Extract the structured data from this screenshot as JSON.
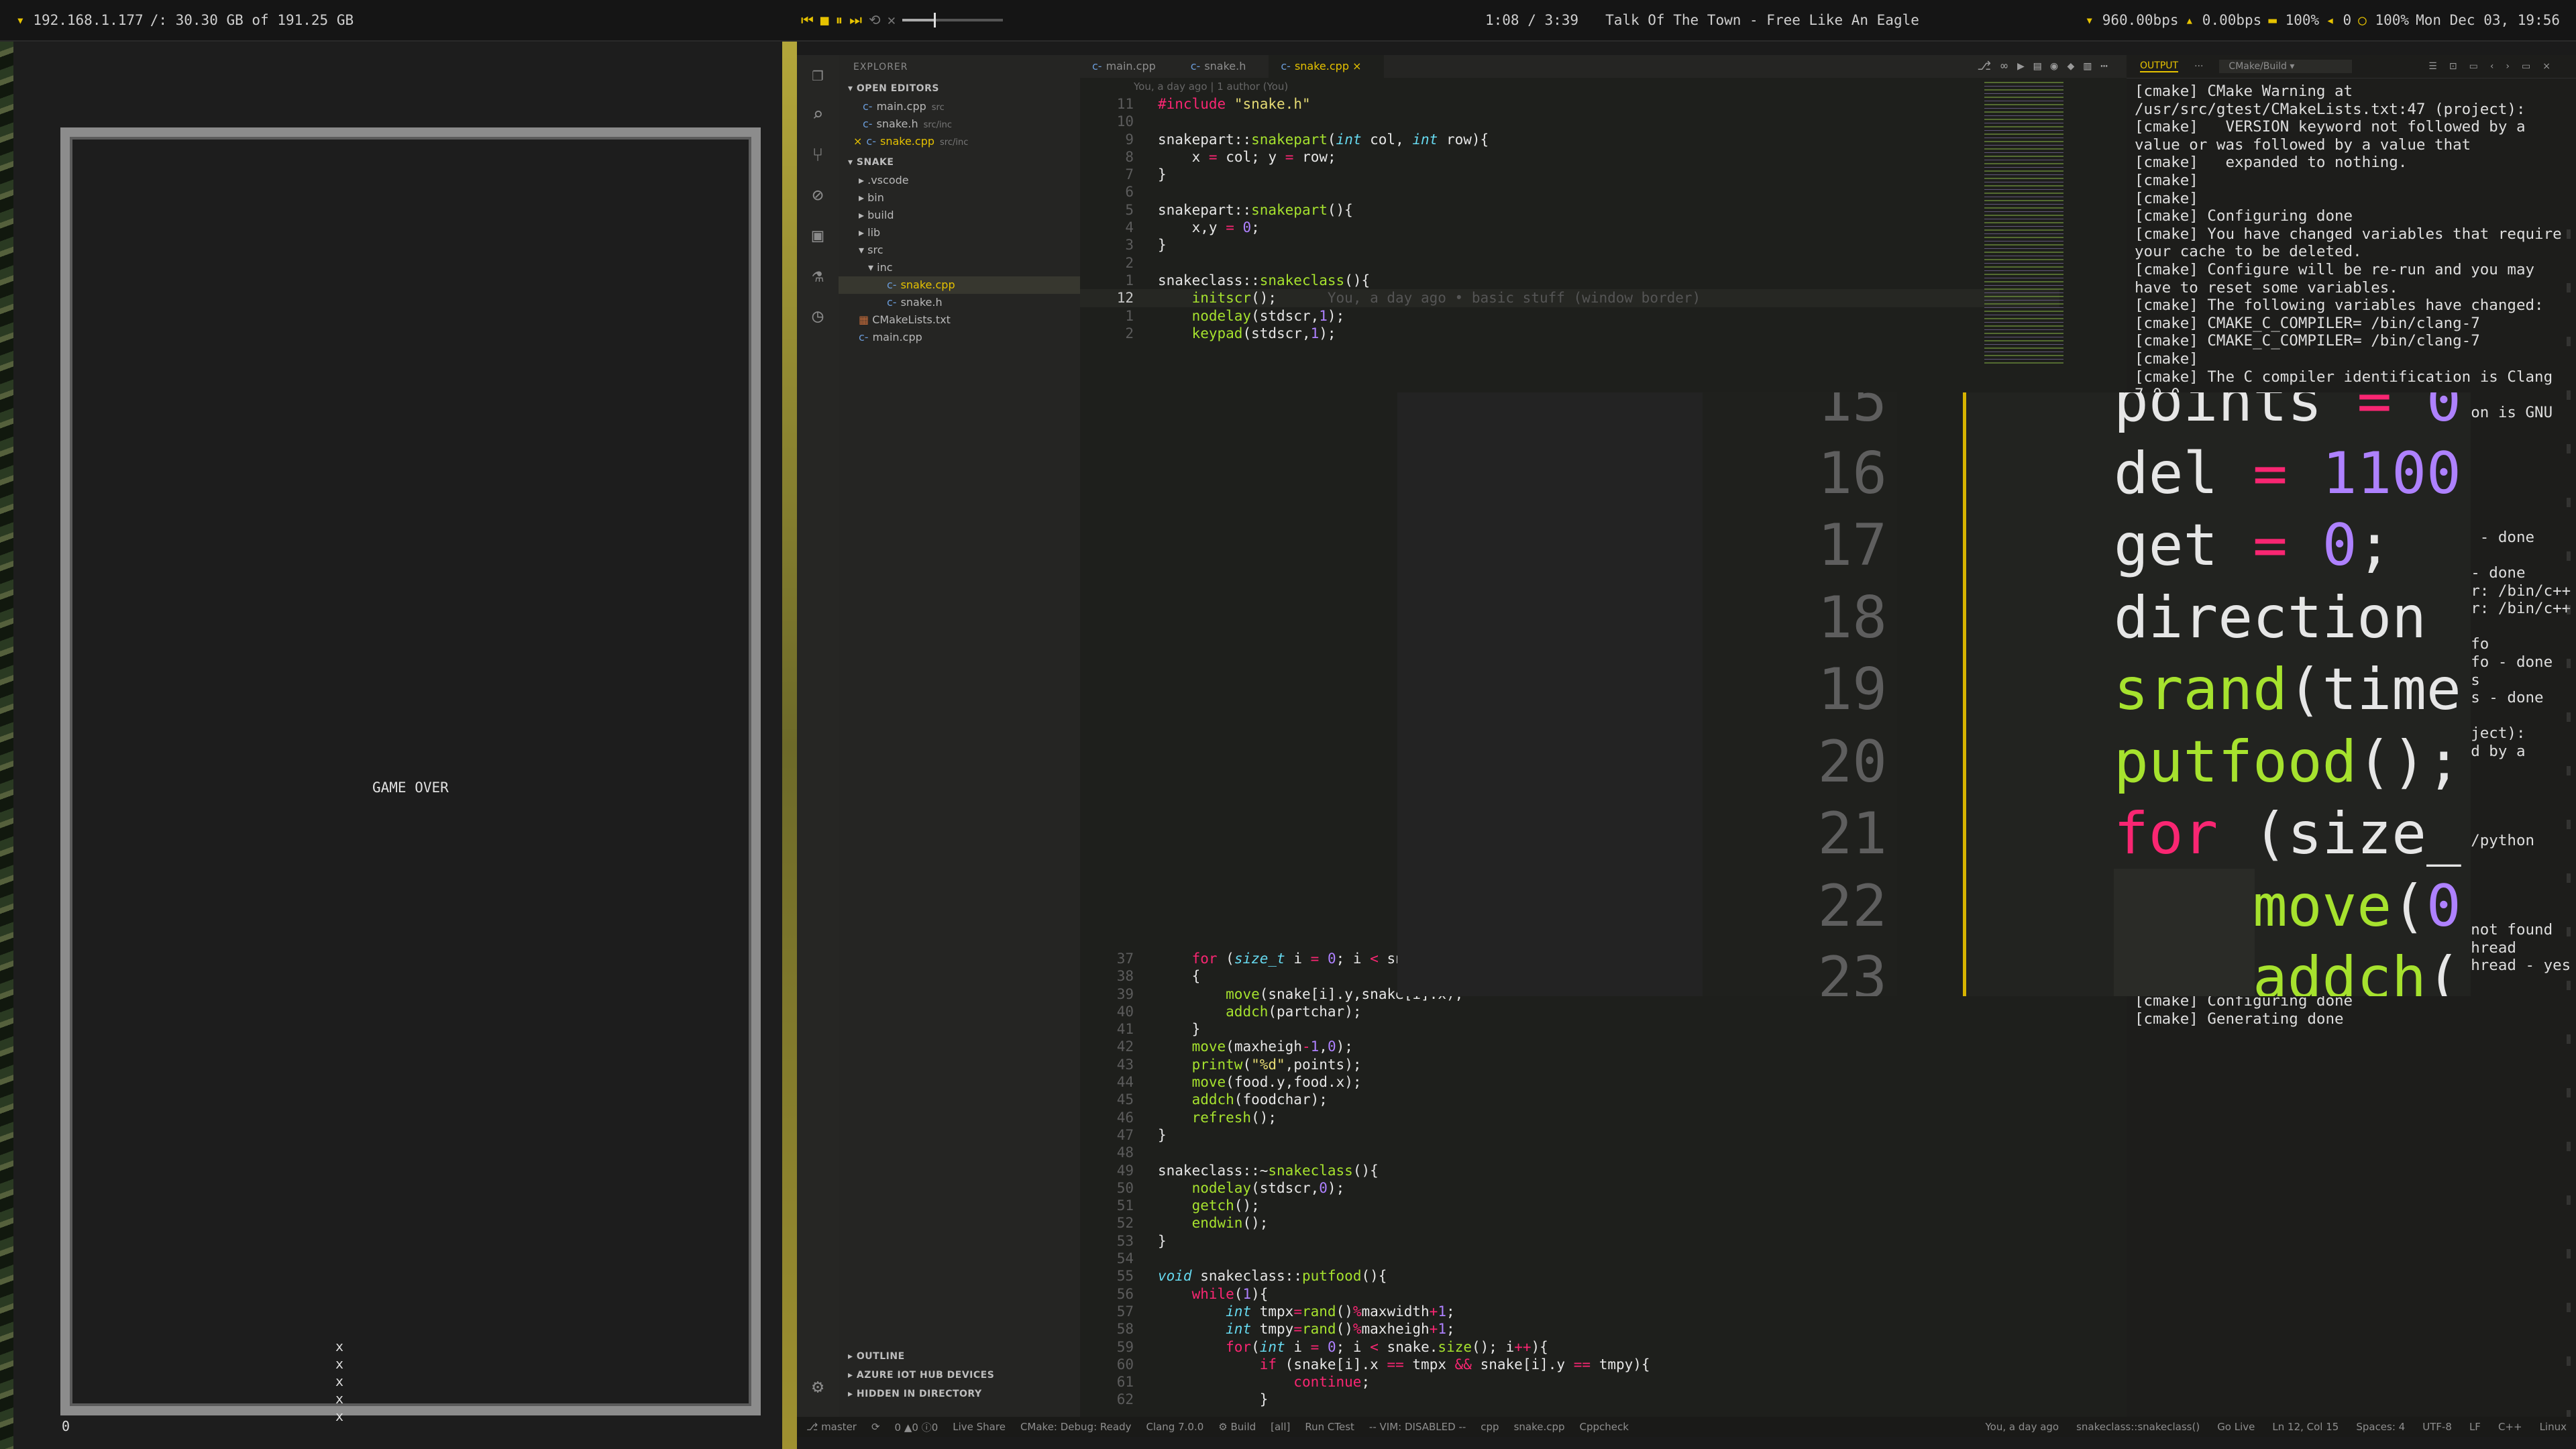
{
  "topbar": {
    "ip": "192.168.1.177",
    "disk": "/: 30.30 GB of 191.25 GB",
    "time_pos": "1:08 / 3:39",
    "track": "Talk Of The Town - Free Like An Eagle",
    "seek_progress": 0.31,
    "down": "960.00bps",
    "up": "0.00bps",
    "battery": "100%",
    "volume": "0",
    "brightness": "100%",
    "datetime": "Mon Dec 03, 19:56"
  },
  "game": {
    "message": "GAME OVER",
    "snake": "x\nx\nx\nx\nx",
    "score": "0"
  },
  "sidebar": {
    "header": "EXPLORER",
    "open_editors": "OPEN EDITORS",
    "open_files": [
      {
        "name": "main.cpp",
        "hint": "src"
      },
      {
        "name": "snake.h",
        "hint": "src/inc"
      },
      {
        "name": "snake.cpp",
        "hint": "src/inc"
      }
    ],
    "project": "SNAKE",
    "tree": [
      ".vscode",
      "bin",
      "build",
      "lib",
      "src",
      "inc",
      "snake.cpp",
      "snake.h",
      "CMakeLists.txt",
      "main.cpp"
    ],
    "outline": "OUTLINE",
    "azure": "AZURE IOT HUB DEVICES",
    "hidden": "HIDDEN IN DIRECTORY"
  },
  "tabs": [
    {
      "label": "main.cpp"
    },
    {
      "label": "snake.h"
    },
    {
      "label": "snake.cpp",
      "close": "×"
    }
  ],
  "editor": {
    "blame_top": "You, a day ago | 1 author (You)",
    "blame_inline": "You, a day ago • basic stuff (window border)",
    "top_lines": [
      {
        "n": "11",
        "t": "#include \"snake.h\""
      },
      {
        "n": "10",
        "t": ""
      },
      {
        "n": "9",
        "t": "snakepart::snakepart(int col, int row){"
      },
      {
        "n": "8",
        "t": "    x = col; y = row;"
      },
      {
        "n": "7",
        "t": "}"
      },
      {
        "n": "6",
        "t": ""
      },
      {
        "n": "5",
        "t": "snakepart::snakepart(){"
      },
      {
        "n": "4",
        "t": "    x,y = 0;"
      },
      {
        "n": "3",
        "t": "}"
      },
      {
        "n": "2",
        "t": ""
      },
      {
        "n": "1",
        "t": "snakeclass::snakeclass(){"
      },
      {
        "n": "12",
        "t": "    initscr();"
      },
      {
        "n": "1",
        "t": "    nodelay(stdscr,1);"
      },
      {
        "n": "2",
        "t": "    keypad(stdscr,1);"
      }
    ],
    "bottom_lines": [
      {
        "n": "37",
        "t": "    for (size_t i = 0; i < snake.size(); i++)"
      },
      {
        "n": "38",
        "t": "    {"
      },
      {
        "n": "39",
        "t": "        move(snake[i].y,snake[i].x);"
      },
      {
        "n": "40",
        "t": "        addch(partchar);"
      },
      {
        "n": "41",
        "t": "    }"
      },
      {
        "n": "42",
        "t": "    move(maxheigh-1,0);"
      },
      {
        "n": "43",
        "t": "    printw(\"%d\",points);"
      },
      {
        "n": "44",
        "t": "    move(food.y,food.x);"
      },
      {
        "n": "45",
        "t": "    addch(foodchar);"
      },
      {
        "n": "46",
        "t": "    refresh();"
      },
      {
        "n": "47",
        "t": "}"
      },
      {
        "n": "48",
        "t": ""
      },
      {
        "n": "49",
        "t": "snakeclass::~snakeclass(){"
      },
      {
        "n": "50",
        "t": "    nodelay(stdscr,0);"
      },
      {
        "n": "51",
        "t": "    getch();"
      },
      {
        "n": "52",
        "t": "    endwin();"
      },
      {
        "n": "53",
        "t": "}"
      },
      {
        "n": "54",
        "t": ""
      },
      {
        "n": "55",
        "t": "void snakeclass::putfood(){"
      },
      {
        "n": "56",
        "t": "    while(1){"
      },
      {
        "n": "57",
        "t": "        int tmpx=rand()%maxwidth+1;"
      },
      {
        "n": "58",
        "t": "        int tmpy=rand()%maxheigh+1;"
      },
      {
        "n": "59",
        "t": "        for(int i = 0; i < snake.size(); i++){"
      },
      {
        "n": "60",
        "t": "            if (snake[i].x == tmpx && snake[i].y == tmpy){"
      },
      {
        "n": "61",
        "t": "                continue;"
      },
      {
        "n": "62",
        "t": "            }"
      }
    ]
  },
  "zoom": {
    "lines": [
      {
        "n": "15",
        "t": "points = 0"
      },
      {
        "n": "16",
        "t": "del = 1100"
      },
      {
        "n": "17",
        "t": "get = 0;"
      },
      {
        "n": "18",
        "t": "direction"
      },
      {
        "n": "19",
        "t": "srand(time"
      },
      {
        "n": "20",
        "t": "putfood();"
      },
      {
        "n": "21",
        "t": "for (size_"
      },
      {
        "n": "22",
        "t": "move(0"
      },
      {
        "n": "23",
        "t": "addch("
      }
    ]
  },
  "output": {
    "tab": "OUTPUT",
    "dots": "···",
    "channel": "CMake/Build",
    "log": "[cmake] CMake Warning at /usr/src/gtest/CMakeLists.txt:47 (project):\n[cmake]   VERSION keyword not followed by a value or was followed by a value that\n[cmake]   expanded to nothing.\n[cmake]\n[cmake]\n[cmake] Configuring done\n[cmake] You have changed variables that require your cache to be deleted.\n[cmake] Configure will be re-run and you may have to reset some variables.\n[cmake] The following variables have changed:\n[cmake] CMAKE_C_COMPILER= /bin/clang-7\n[cmake] CMAKE_C_COMPILER= /bin/clang-7\n[cmake]\n[cmake] The C compiler identification is Clang 7.0.0\n[cmake] The CXX compiler identification is GNU 8.2.1\n[cmake] Check for working C compiler: /bin/clang-7\n[cmake] Check for working C compiler: /bin/clang-7 -- works\n[cmake] Detecting C compiler ABI info\n[cmake] Detecting C compiler ABI info - done\n[cmake] Detecting C compile features\n[cmake] Detecting C compile features - done\n[cmake] Check for working CXX compiler: /bin/c++\n[cmake] Check for working CXX compiler: /bin/c++ -- works\n[cmake] Detecting CXX compiler ABI info\n[cmake] Detecting CXX compiler ABI info - done\n[cmake] Detecting CXX compile features\n[cmake] Detecting CXX compile features - done\n[cmake] CMake Warning at /usr/src/gtest/CMakeLists.txt:47 (project):\n[cmake]   VERSION keyword not followed by a value or was followed by a value that\n[cmake]   expanded to nothing.\n[cmake]\n[cmake]\n[cmake] Found PythonInterp: /usr/sbin/python (found version \"3.7.1\")\n[cmake] Looking for pthread.h\n[cmake] Looking for pthread.h - found\n[cmake] Looking for pthread_create\n[cmake] Looking for pthread_create - not found\n[cmake] Check if compiler accepts -pthread\n[cmake] Check if compiler accepts -pthread - yes\n[cmake] Found Threads: TRUE\n[cmake] Configuring done\n[cmake] Generating done"
  },
  "status": {
    "branch": "master",
    "problems": "0 ▲0 ⓘ0",
    "liveshare": "Live Share",
    "cmake": "CMake: Debug: Ready",
    "kit": "Clang 7.0.0",
    "build": "Build",
    "all": "[all]",
    "run": "Run CTest",
    "vim": "-- VIM: DISABLED --",
    "lang1": "cpp",
    "file": "snake.cpp",
    "cppcheck": "Cppcheck",
    "blame": "You, a day ago",
    "scope": "snakeclass::snakeclass()",
    "golive": "Go Live",
    "pos": "Ln 12, Col 15",
    "spaces": "Spaces: 4",
    "enc": "UTF-8",
    "eol": "LF",
    "lang": "C++",
    "os": "Linux"
  }
}
